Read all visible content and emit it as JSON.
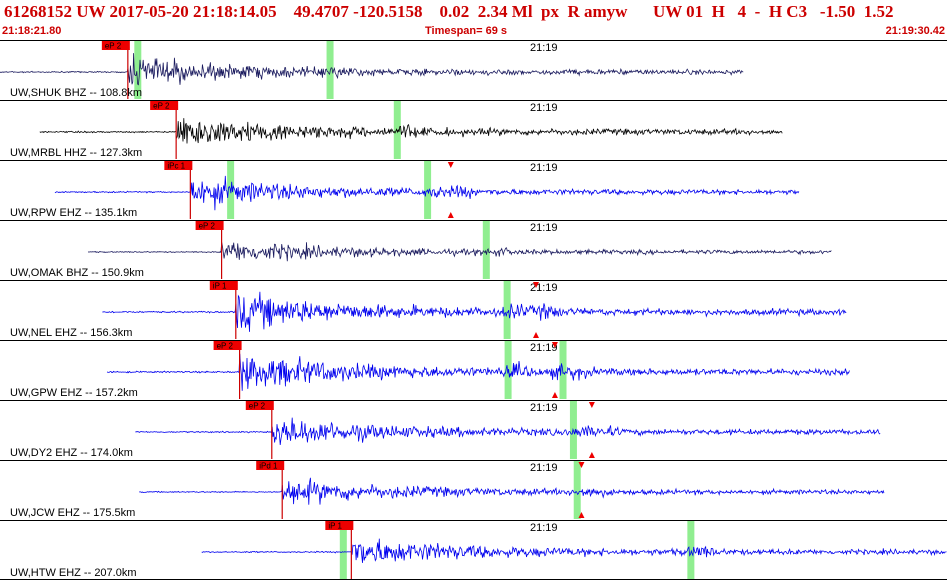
{
  "header": {
    "line": "61268152 UW 2017-05-20 21:18:14.05    49.4707 -120.5158    0.02  2.34 Ml  px  R amyw      UW 01  H   4  -  H C3   -1.50  1.52",
    "start_time": "21:18:21.80",
    "timespan": "Timespan=  69 s",
    "end_time": "21:19:30.42"
  },
  "colors": {
    "header_text": "#cc0000",
    "trace_dark": "#1a1a5e",
    "trace_black": "#000000",
    "trace_blue": "#0000ee",
    "pick_box": "#ee0000",
    "window_band": "#90ee90",
    "separator": "#000000"
  },
  "traces": [
    {
      "label": "UW,SHUK BHZ -- 108.8km",
      "pick": "eP 2",
      "minute_mark": "21:19",
      "color": "dark",
      "pick_t": 0.135,
      "start": 0.0,
      "end": 0.785,
      "amp": 0.45,
      "bands": [
        0.145,
        0.348
      ],
      "markers": []
    },
    {
      "label": "UW,MRBL HHZ -- 127.3km",
      "pick": "eP 2",
      "minute_mark": "21:19",
      "color": "black",
      "pick_t": 0.186,
      "start": 0.042,
      "end": 0.826,
      "amp": 0.5,
      "bands": [
        0.419
      ],
      "markers": []
    },
    {
      "label": "UW,RPW EHZ -- 135.1km",
      "pick": "iPc 1",
      "minute_mark": "21:19",
      "color": "blue",
      "pick_t": 0.201,
      "start": 0.058,
      "end": 0.844,
      "amp": 0.45,
      "bands": [
        0.243,
        0.451
      ],
      "markers": [
        0.476
      ]
    },
    {
      "label": "UW,OMAK BHZ -- 150.9km",
      "pick": "eP 2",
      "minute_mark": "21:19",
      "color": "dark",
      "pick_t": 0.234,
      "start": 0.093,
      "end": 0.878,
      "amp": 0.35,
      "bands": [
        0.513
      ],
      "markers": []
    },
    {
      "label": "UW,NEL EHZ -- 156.3km",
      "pick": "iP 1",
      "minute_mark": "21:19",
      "color": "blue",
      "pick_t": 0.249,
      "start": 0.108,
      "end": 0.894,
      "amp": 0.55,
      "bands": [
        0.535
      ],
      "markers": [
        0.566
      ]
    },
    {
      "label": "UW,GPW EHZ -- 157.2km",
      "pick": "eP 2",
      "minute_mark": "21:19",
      "color": "blue",
      "pick_t": 0.253,
      "start": 0.113,
      "end": 0.897,
      "amp": 0.55,
      "bands": [
        0.536,
        0.594
      ],
      "markers": [
        0.586
      ]
    },
    {
      "label": "UW,DY2 EHZ -- 174.0km",
      "pick": "eP 2",
      "minute_mark": "21:19",
      "color": "blue",
      "pick_t": 0.287,
      "start": 0.143,
      "end": 0.93,
      "amp": 0.45,
      "bands": [
        0.605
      ],
      "markers": [
        0.625
      ]
    },
    {
      "label": "UW,JCW EHZ -- 175.5km",
      "pick": "iPd 1",
      "minute_mark": "21:19",
      "color": "blue",
      "pick_t": 0.298,
      "start": 0.147,
      "end": 0.934,
      "amp": 0.4,
      "bands": [
        0.609
      ],
      "markers": [
        0.614
      ]
    },
    {
      "label": "UW,HTW EHZ -- 207.0km",
      "pick": "iP 1",
      "minute_mark": "21:19",
      "color": "blue",
      "pick_t": 0.371,
      "start": 0.213,
      "end": 1.0,
      "amp": 0.45,
      "bands": [
        0.362,
        0.729
      ],
      "markers": []
    }
  ]
}
